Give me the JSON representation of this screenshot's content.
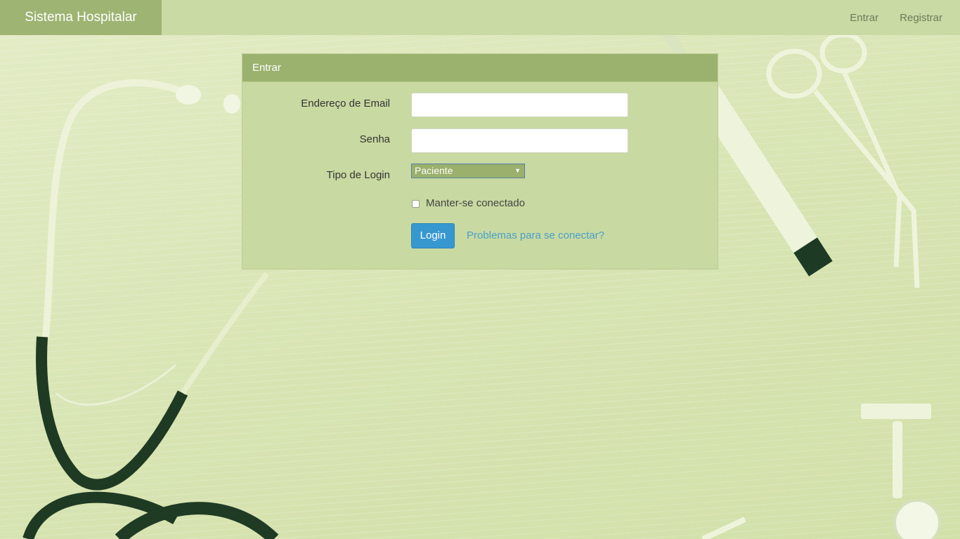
{
  "navbar": {
    "brand": "Sistema Hospitalar",
    "links": [
      "Entrar",
      "Registrar"
    ]
  },
  "login_panel": {
    "heading": "Entrar",
    "email_label": "Endereço de Email",
    "email_value": "",
    "password_label": "Senha",
    "password_value": "",
    "login_type_label": "Tipo de Login",
    "login_type_selected": "Paciente",
    "remember_label": "Manter-se conectado",
    "remember_checked": false,
    "login_button": "Login",
    "problems_link": "Problemas para se conectar?"
  },
  "colors": {
    "brand_bg": "#9db472",
    "navbar_bg": "#c9daa4",
    "panel_heading_bg": "#9bb26f",
    "panel_body_bg": "#c8d9a1",
    "button_bg": "#3798d0",
    "link": "#4aa0c8"
  },
  "icons": [
    "select-arrow-icon",
    "stethoscope-background",
    "scissors-background",
    "penlight-background",
    "watch-background"
  ]
}
